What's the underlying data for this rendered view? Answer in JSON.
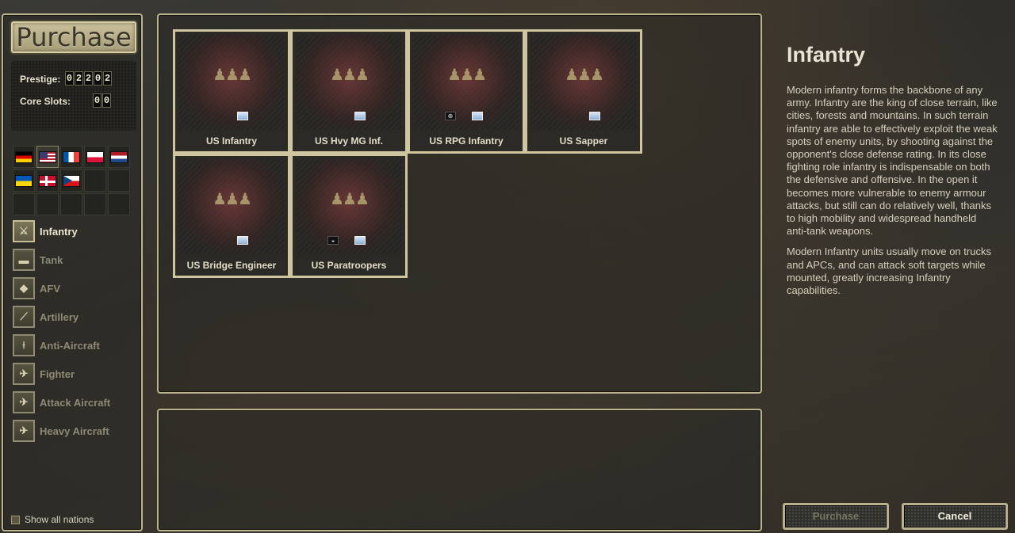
{
  "header": {
    "title": "Purchase"
  },
  "stats": {
    "prestige_label": "Prestige:",
    "prestige_digits": [
      "0",
      "2",
      "2",
      "0",
      "2"
    ],
    "core_slots_label": "Core Slots:",
    "core_slots_digits": [
      "0",
      "0"
    ]
  },
  "nations": [
    {
      "name": "germany-flag",
      "style": "de"
    },
    {
      "name": "usa-flag",
      "style": "us",
      "selected": true
    },
    {
      "name": "france-flag",
      "style": "fr"
    },
    {
      "name": "poland-flag",
      "style": "pl"
    },
    {
      "name": "netherlands-flag",
      "style": "nl"
    },
    {
      "name": "ukraine-flag",
      "style": "ua"
    },
    {
      "name": "denmark-flag",
      "style": "dk"
    },
    {
      "name": "czech-flag",
      "style": "cz"
    }
  ],
  "categories": [
    {
      "label": "Infantry",
      "icon": "infantry-icon",
      "glyph": "⚔",
      "active": true
    },
    {
      "label": "Tank",
      "icon": "tank-icon",
      "glyph": "▬"
    },
    {
      "label": "AFV",
      "icon": "afv-icon",
      "glyph": "◆"
    },
    {
      "label": "Artillery",
      "icon": "artillery-icon",
      "glyph": "⟋"
    },
    {
      "label": "Anti-Aircraft",
      "icon": "anti-aircraft-icon",
      "glyph": "⟊"
    },
    {
      "label": "Fighter",
      "icon": "fighter-icon",
      "glyph": "✈"
    },
    {
      "label": "Attack Aircraft",
      "icon": "attack-aircraft-icon",
      "glyph": "✈"
    },
    {
      "label": "Heavy Aircraft",
      "icon": "heavy-aircraft-icon",
      "glyph": "✈"
    }
  ],
  "show_all_nations_label": "Show all nations",
  "units": [
    {
      "name": "US Infantry",
      "badge_pos": "center"
    },
    {
      "name": "US Hvy MG Inf.",
      "badge_pos": "right"
    },
    {
      "name": "US RPG Infantry",
      "badge_pos": "right",
      "trait": "⊕"
    },
    {
      "name": "US Sapper",
      "badge_pos": "right"
    },
    {
      "name": "US Bridge Engineer",
      "badge_pos": "center"
    },
    {
      "name": "US Paratroopers",
      "badge_pos": "right",
      "trait": "◒"
    }
  ],
  "info": {
    "title": "Infantry",
    "paragraphs": [
      "Modern infantry forms the backbone of any army. Infantry are the king of close terrain, like cities, forests and mountains. In such terrain infantry are able to effectively exploit the weak spots of enemy units, by shooting against the opponent's close defense rating. In its close fighting role infantry is indispensable on both the defensive and offensive. In the open it becomes more vulnerable to enemy armour attacks, but still can do relatively well, thanks to high mobility and widespread handheld anti-tank weapons.",
      "Modern Infantry units usually move on trucks and APCs, and can attack soft targets while mounted, greatly increasing Infantry capabilities."
    ]
  },
  "buttons": {
    "purchase": "Purchase",
    "cancel": "Cancel"
  }
}
